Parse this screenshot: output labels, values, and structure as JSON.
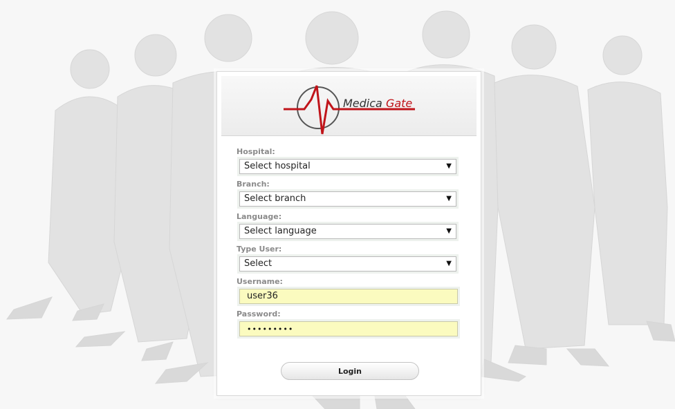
{
  "logo": {
    "word1": "Medica",
    "word2": "Gate",
    "accent_color": "#c0141a"
  },
  "form": {
    "hospital": {
      "label": "Hospital:",
      "selected": "Select hospital"
    },
    "branch": {
      "label": "Branch:",
      "selected": "Select branch"
    },
    "language": {
      "label": "Language:",
      "selected": "Select language"
    },
    "type_user": {
      "label": "Type User:",
      "selected": "Select"
    },
    "username": {
      "label": "Username:",
      "value": "user36"
    },
    "password": {
      "label": "Password:",
      "masked": "•••••••••"
    },
    "login_label": "Login"
  },
  "icons": {
    "dropdown_arrow": "▼"
  }
}
